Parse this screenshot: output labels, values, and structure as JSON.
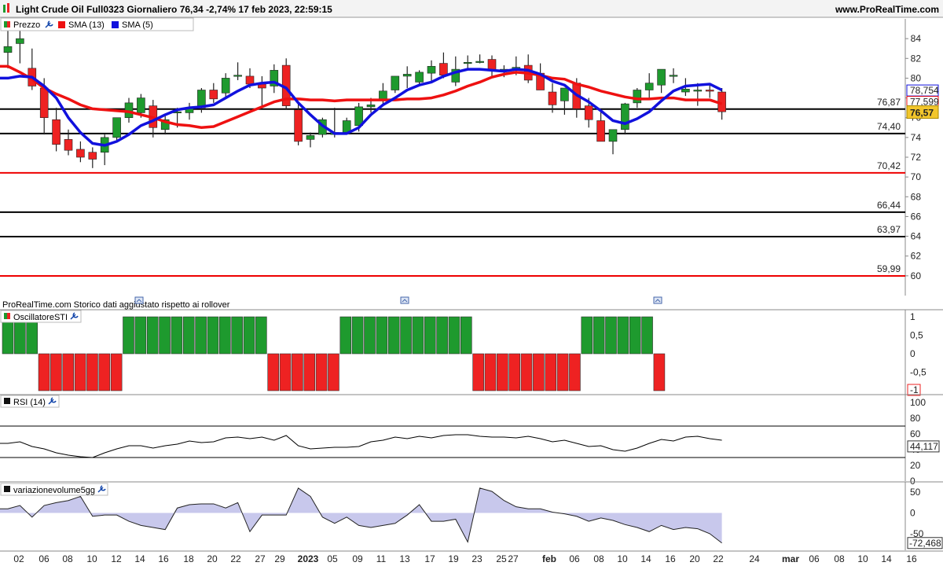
{
  "header": {
    "title": "Light Crude Oil Full0323 Giornaliero 76,34 -2,74% 17 feb 2023, 22:59:15",
    "site": "www.ProRealTime.com"
  },
  "legend": {
    "price": "Prezzo",
    "sma13": "SMA (13)",
    "sma5": "SMA (5)"
  },
  "footer_note": "ProRealTime.com  Storico dati aggiustato rispetto ai rollover",
  "colors": {
    "up": "#1e9a2e",
    "down": "#ee2222",
    "sma13": "#ee1111",
    "sma5": "#1111dd",
    "sti_up": "#1e9a2e",
    "sti_down": "#ee2222",
    "area_fill": "#c8c8ec",
    "current_price_bg": "#f2c62c"
  },
  "panels": {
    "sti": {
      "label": "OscillatoreSTI"
    },
    "rsi": {
      "label": "RSI (14)"
    },
    "vol": {
      "label": "variazionevolume5gg"
    }
  },
  "chart_data": [
    {
      "type": "candlestick",
      "title": "Light Crude Oil Full0323 Giornaliero",
      "ylim": [
        58,
        86
      ],
      "yticks": [
        "60",
        "62",
        "64",
        "66",
        "68",
        "70",
        "72",
        "74",
        "76",
        "78",
        "80",
        "82",
        "84"
      ],
      "candles": [
        {
          "o": 82.6,
          "h": 85.2,
          "l": 81.0,
          "c": 83.2
        },
        {
          "o": 83.5,
          "h": 84.8,
          "l": 81.5,
          "c": 84.0
        },
        {
          "o": 81.0,
          "h": 83.0,
          "l": 78.8,
          "c": 79.2
        },
        {
          "o": 79.0,
          "h": 80.0,
          "l": 74.3,
          "c": 76.0
        },
        {
          "o": 75.8,
          "h": 77.0,
          "l": 72.6,
          "c": 73.3
        },
        {
          "o": 73.8,
          "h": 74.8,
          "l": 72.2,
          "c": 72.7
        },
        {
          "o": 72.8,
          "h": 73.6,
          "l": 71.5,
          "c": 72.0
        },
        {
          "o": 72.5,
          "h": 73.0,
          "l": 70.9,
          "c": 71.8
        },
        {
          "o": 72.5,
          "h": 74.3,
          "l": 71.2,
          "c": 74.0
        },
        {
          "o": 74.0,
          "h": 75.8,
          "l": 73.5,
          "c": 76.0
        },
        {
          "o": 76.0,
          "h": 78.0,
          "l": 75.5,
          "c": 77.5
        },
        {
          "o": 76.5,
          "h": 78.4,
          "l": 76.0,
          "c": 78.0
        },
        {
          "o": 77.2,
          "h": 77.8,
          "l": 74.0,
          "c": 75.0
        },
        {
          "o": 74.8,
          "h": 76.2,
          "l": 74.3,
          "c": 75.8
        },
        {
          "o": 76.5,
          "h": 77.0,
          "l": 75.0,
          "c": 76.6
        },
        {
          "o": 76.5,
          "h": 77.5,
          "l": 75.8,
          "c": 77.0
        },
        {
          "o": 77.0,
          "h": 79.0,
          "l": 76.5,
          "c": 78.8
        },
        {
          "o": 78.8,
          "h": 79.5,
          "l": 77.5,
          "c": 77.9
        },
        {
          "o": 78.5,
          "h": 80.5,
          "l": 78.0,
          "c": 80.0
        },
        {
          "o": 80.3,
          "h": 81.6,
          "l": 79.8,
          "c": 80.3
        },
        {
          "o": 80.2,
          "h": 81.0,
          "l": 79.0,
          "c": 79.4
        },
        {
          "o": 79.4,
          "h": 80.2,
          "l": 77.2,
          "c": 79.0
        },
        {
          "o": 79.2,
          "h": 81.4,
          "l": 78.5,
          "c": 80.8
        },
        {
          "o": 81.3,
          "h": 82.0,
          "l": 76.8,
          "c": 77.2
        },
        {
          "o": 76.8,
          "h": 77.5,
          "l": 73.2,
          "c": 73.6
        },
        {
          "o": 73.8,
          "h": 74.5,
          "l": 73.0,
          "c": 74.2
        },
        {
          "o": 74.3,
          "h": 76.0,
          "l": 74.0,
          "c": 75.8
        },
        {
          "o": 74.3,
          "h": 77.0,
          "l": 74.0,
          "c": 74.5
        },
        {
          "o": 74.5,
          "h": 76.0,
          "l": 74.3,
          "c": 75.7
        },
        {
          "o": 75.2,
          "h": 77.5,
          "l": 74.6,
          "c": 77.1
        },
        {
          "o": 77.1,
          "h": 78.0,
          "l": 76.5,
          "c": 77.3
        },
        {
          "o": 77.8,
          "h": 79.5,
          "l": 77.2,
          "c": 78.7
        },
        {
          "o": 78.8,
          "h": 80.2,
          "l": 78.5,
          "c": 80.2
        },
        {
          "o": 80.2,
          "h": 81.2,
          "l": 79.0,
          "c": 80.4
        },
        {
          "o": 79.6,
          "h": 80.8,
          "l": 79.2,
          "c": 80.6
        },
        {
          "o": 80.5,
          "h": 81.8,
          "l": 79.5,
          "c": 81.2
        },
        {
          "o": 81.5,
          "h": 82.6,
          "l": 80.0,
          "c": 80.3
        },
        {
          "o": 79.6,
          "h": 82.2,
          "l": 79.2,
          "c": 80.9
        },
        {
          "o": 81.5,
          "h": 82.3,
          "l": 81.0,
          "c": 81.6
        },
        {
          "o": 81.7,
          "h": 82.4,
          "l": 81.5,
          "c": 81.7
        },
        {
          "o": 81.9,
          "h": 82.3,
          "l": 80.0,
          "c": 80.8
        },
        {
          "o": 80.9,
          "h": 81.3,
          "l": 80.1,
          "c": 80.9
        },
        {
          "o": 80.9,
          "h": 82.2,
          "l": 80.3,
          "c": 81.1
        },
        {
          "o": 81.3,
          "h": 82.4,
          "l": 79.5,
          "c": 79.8
        },
        {
          "o": 80.5,
          "h": 81.5,
          "l": 79.3,
          "c": 78.8
        },
        {
          "o": 78.6,
          "h": 79.5,
          "l": 76.5,
          "c": 77.3
        },
        {
          "o": 77.7,
          "h": 78.5,
          "l": 76.3,
          "c": 79.0
        },
        {
          "o": 79.5,
          "h": 80.0,
          "l": 76.0,
          "c": 76.9
        },
        {
          "o": 77.2,
          "h": 78.0,
          "l": 75.0,
          "c": 75.8
        },
        {
          "o": 75.7,
          "h": 76.8,
          "l": 73.6,
          "c": 73.6
        },
        {
          "o": 73.6,
          "h": 74.6,
          "l": 72.3,
          "c": 74.8
        },
        {
          "o": 74.8,
          "h": 77.5,
          "l": 74.3,
          "c": 77.4
        },
        {
          "o": 77.5,
          "h": 79.0,
          "l": 77.0,
          "c": 78.8
        },
        {
          "o": 78.8,
          "h": 80.5,
          "l": 78.0,
          "c": 79.5
        },
        {
          "o": 79.3,
          "h": 80.5,
          "l": 78.5,
          "c": 80.9
        },
        {
          "o": 80.2,
          "h": 81.0,
          "l": 79.5,
          "c": 80.3
        },
        {
          "o": 78.6,
          "h": 80.0,
          "l": 78.2,
          "c": 78.9
        },
        {
          "o": 78.8,
          "h": 79.5,
          "l": 77.2,
          "c": 78.8
        },
        {
          "o": 78.8,
          "h": 79.5,
          "l": 78.0,
          "c": 78.7
        },
        {
          "o": 78.6,
          "h": 79.0,
          "l": 75.8,
          "c": 76.6
        }
      ],
      "sma13": [
        81.2,
        80.6,
        79.9,
        79.0,
        78.4,
        77.9,
        77.3,
        76.9,
        76.8,
        76.7,
        76.6,
        76.3,
        76.0,
        75.6,
        75.3,
        75.2,
        75.0,
        75.1,
        75.6,
        76.1,
        76.6,
        77.1,
        77.6,
        77.9,
        77.9,
        77.8,
        77.8,
        77.7,
        77.8,
        77.8,
        77.8,
        77.8,
        77.8,
        77.9,
        77.9,
        78.0,
        78.3,
        78.7,
        79.2,
        79.6,
        80.1,
        80.4,
        80.6,
        80.5,
        80.3,
        80.0,
        79.9,
        79.4,
        79.1,
        78.7,
        78.4,
        78.1,
        77.9,
        77.9,
        78.0,
        78.0,
        77.8,
        77.8,
        77.8,
        77.4
      ],
      "sma5": [
        80.0,
        80.2,
        80.1,
        79.2,
        78.0,
        76.0,
        74.5,
        73.4,
        73.2,
        73.6,
        74.3,
        75.2,
        75.7,
        76.3,
        76.8,
        77.0,
        77.1,
        77.3,
        78.0,
        78.7,
        79.3,
        79.5,
        79.6,
        79.0,
        77.5,
        76.3,
        75.2,
        74.4,
        74.4,
        75.0,
        76.3,
        77.3,
        78.0,
        78.8,
        79.3,
        79.6,
        80.2,
        80.6,
        80.9,
        80.9,
        80.8,
        80.7,
        80.9,
        80.8,
        80.4,
        79.7,
        79.3,
        78.3,
        77.6,
        76.7,
        75.7,
        75.4,
        75.9,
        76.6,
        77.7,
        78.7,
        79.2,
        79.3,
        79.4,
        78.8
      ],
      "hlines": [
        {
          "value": 76.87,
          "label": "76,87",
          "color": "#000000"
        },
        {
          "value": 74.4,
          "label": "74,40",
          "color": "#000000"
        },
        {
          "value": 70.42,
          "label": "70,42",
          "color": "#ee0000"
        },
        {
          "value": 66.44,
          "label": "66,44",
          "color": "#000000"
        },
        {
          "value": 63.97,
          "label": "63,97",
          "color": "#000000"
        },
        {
          "value": 59.99,
          "label": "59,99",
          "color": "#ee0000"
        }
      ],
      "badges": [
        {
          "value": 78.754,
          "label": "78,754",
          "color": "#1111dd"
        },
        {
          "value": 77.599,
          "label": "77,599",
          "color": "#ee1111"
        },
        {
          "value": 76.57,
          "label": "76,57",
          "color": "#000000"
        }
      ]
    },
    {
      "type": "bar",
      "title": "OscillatoreSTI",
      "ylim": [
        -1,
        1
      ],
      "yticks": [
        "1",
        "0,5",
        "0",
        "-0,5"
      ],
      "values": [
        1,
        1,
        1,
        -1,
        -1,
        -1,
        -1,
        -1,
        -1,
        -1,
        1,
        1,
        1,
        1,
        1,
        1,
        1,
        1,
        1,
        1,
        1,
        1,
        -1,
        -1,
        -1,
        -1,
        -1,
        -1,
        1,
        1,
        1,
        1,
        1,
        1,
        1,
        1,
        1,
        1,
        1,
        -1,
        -1,
        -1,
        -1,
        -1,
        -1,
        -1,
        -1,
        -1,
        1,
        1,
        1,
        1,
        1,
        1,
        -1
      ],
      "last_value_label": "-1"
    },
    {
      "type": "line",
      "title": "RSI (14)",
      "ylim": [
        0,
        110
      ],
      "yticks": [
        "100",
        "80",
        "60",
        "40",
        "20",
        "0"
      ],
      "levels": [
        70,
        30
      ],
      "values": [
        48,
        50,
        44,
        41,
        36,
        33,
        31,
        30,
        36,
        41,
        45,
        45,
        42,
        45,
        47,
        51,
        49,
        50,
        55,
        56,
        54,
        56,
        52,
        58,
        45,
        41,
        42,
        43,
        43,
        44,
        50,
        52,
        56,
        54,
        57,
        55,
        58,
        59,
        59,
        57,
        56,
        56,
        55,
        57,
        54,
        50,
        52,
        48,
        44,
        45,
        40,
        38,
        42,
        48,
        53,
        51,
        56,
        57,
        54,
        52
      ],
      "last_label": "44,117"
    },
    {
      "type": "area",
      "title": "variazionevolume5gg",
      "ylim": [
        -90,
        75
      ],
      "yticks": [
        "50",
        "0",
        "-50"
      ],
      "values": [
        10,
        18,
        -10,
        18,
        25,
        30,
        40,
        -8,
        -5,
        -5,
        -20,
        -30,
        -35,
        -40,
        12,
        20,
        22,
        22,
        12,
        25,
        -45,
        -5,
        -5,
        -5,
        60,
        40,
        -10,
        -25,
        -10,
        -30,
        -35,
        -30,
        -25,
        -5,
        20,
        -20,
        -20,
        -15,
        -70,
        60,
        52,
        30,
        15,
        10,
        10,
        2,
        -2,
        -8,
        -20,
        -12,
        -18,
        -28,
        -35,
        -45,
        -30,
        -40,
        -35,
        -38,
        -50,
        -72.468
      ],
      "last_label": "-72,468"
    }
  ],
  "xaxis": {
    "labels": [
      {
        "text": "02",
        "bold": false
      },
      {
        "text": "06",
        "bold": false
      },
      {
        "text": "08",
        "bold": false
      },
      {
        "text": "10",
        "bold": false
      },
      {
        "text": "12",
        "bold": false
      },
      {
        "text": "14",
        "bold": false
      },
      {
        "text": "16",
        "bold": false
      },
      {
        "text": "18",
        "bold": false
      },
      {
        "text": "20",
        "bold": false
      },
      {
        "text": "22",
        "bold": false
      },
      {
        "text": "27",
        "bold": false
      },
      {
        "text": "29",
        "bold": false
      },
      {
        "text": "2023",
        "bold": true
      },
      {
        "text": "05",
        "bold": false
      },
      {
        "text": "09",
        "bold": false
      },
      {
        "text": "11",
        "bold": false
      },
      {
        "text": "13",
        "bold": false
      },
      {
        "text": "17",
        "bold": false
      },
      {
        "text": "19",
        "bold": false
      },
      {
        "text": "23",
        "bold": false
      },
      {
        "text": "25",
        "bold": false
      },
      {
        "text": "27",
        "bold": false
      },
      {
        "text": "feb",
        "bold": true
      },
      {
        "text": "06",
        "bold": false
      },
      {
        "text": "08",
        "bold": false
      },
      {
        "text": "10",
        "bold": false
      },
      {
        "text": "14",
        "bold": false
      },
      {
        "text": "16",
        "bold": false
      },
      {
        "text": "20",
        "bold": false
      },
      {
        "text": "22",
        "bold": false
      },
      {
        "text": "24",
        "bold": false
      },
      {
        "text": "mar",
        "bold": true
      },
      {
        "text": "06",
        "bold": false
      },
      {
        "text": "08",
        "bold": false
      },
      {
        "text": "10",
        "bold": false
      },
      {
        "text": "14",
        "bold": false
      },
      {
        "text": "16",
        "bold": false
      }
    ]
  },
  "icons": {
    "wrench": "wrench-icon",
    "marker": "calendar-marker-icon"
  }
}
